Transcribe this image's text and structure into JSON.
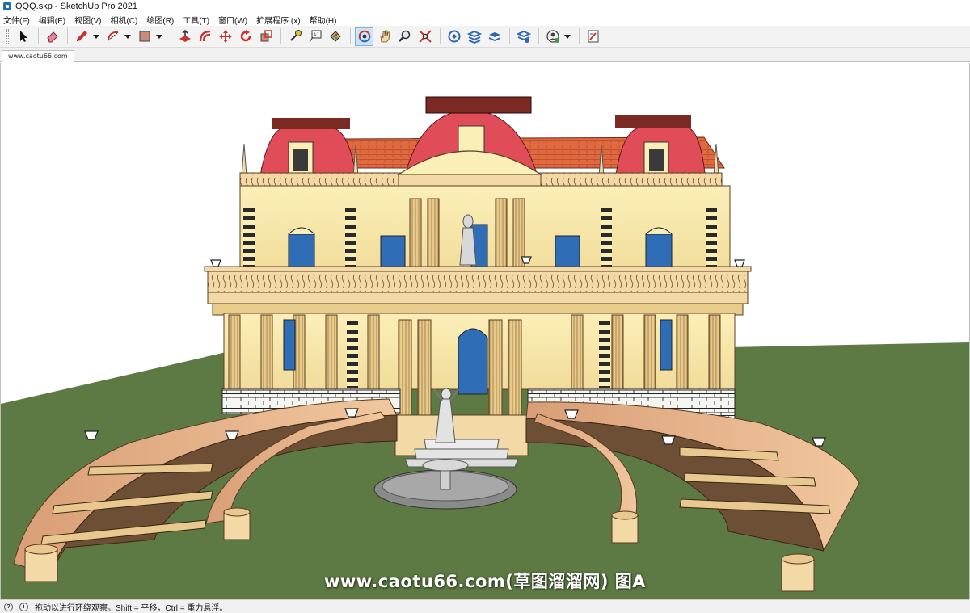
{
  "window": {
    "title": "QQQ.skp - SketchUp Pro 2021"
  },
  "menu": [
    {
      "label": "文件(F)",
      "name": "menu-file"
    },
    {
      "label": "编辑(E)",
      "name": "menu-edit"
    },
    {
      "label": "视图(V)",
      "name": "menu-view"
    },
    {
      "label": "相机(C)",
      "name": "menu-camera"
    },
    {
      "label": "绘图(R)",
      "name": "menu-draw"
    },
    {
      "label": "工具(T)",
      "name": "menu-tools"
    },
    {
      "label": "窗口(W)",
      "name": "menu-window"
    },
    {
      "label": "扩展程序 (x)",
      "name": "menu-extensions"
    },
    {
      "label": "帮助(H)",
      "name": "menu-help"
    }
  ],
  "toolbar": {
    "tools": [
      "select-icon",
      "eraser-icon",
      "pencil-icon",
      "arc-icon",
      "rectangle-icon",
      "push-pull-icon",
      "offset-icon",
      "move-icon",
      "rotate-icon",
      "scale-icon",
      "tape-measure-icon",
      "text-icon",
      "paint-bucket-icon",
      "orbit-icon",
      "pan-icon",
      "zoom-icon",
      "zoom-extents-icon",
      "warehouse-icon",
      "extension-warehouse-icon",
      "layout-icon",
      "extension-manager-icon",
      "account-icon",
      "feedback-icon"
    ],
    "active_tool": "orbit-icon"
  },
  "scene_tab": {
    "label": "www.caotu66.com"
  },
  "viewport": {
    "sky_color": "#ffffff",
    "ground_color": "#5e7a44",
    "watermark": "www.caotu66.com(草图溜溜网) 图A"
  },
  "status": {
    "text": "拖动以进行环绕观察。Shift = 平移，Ctrl = 重力悬浮。"
  }
}
